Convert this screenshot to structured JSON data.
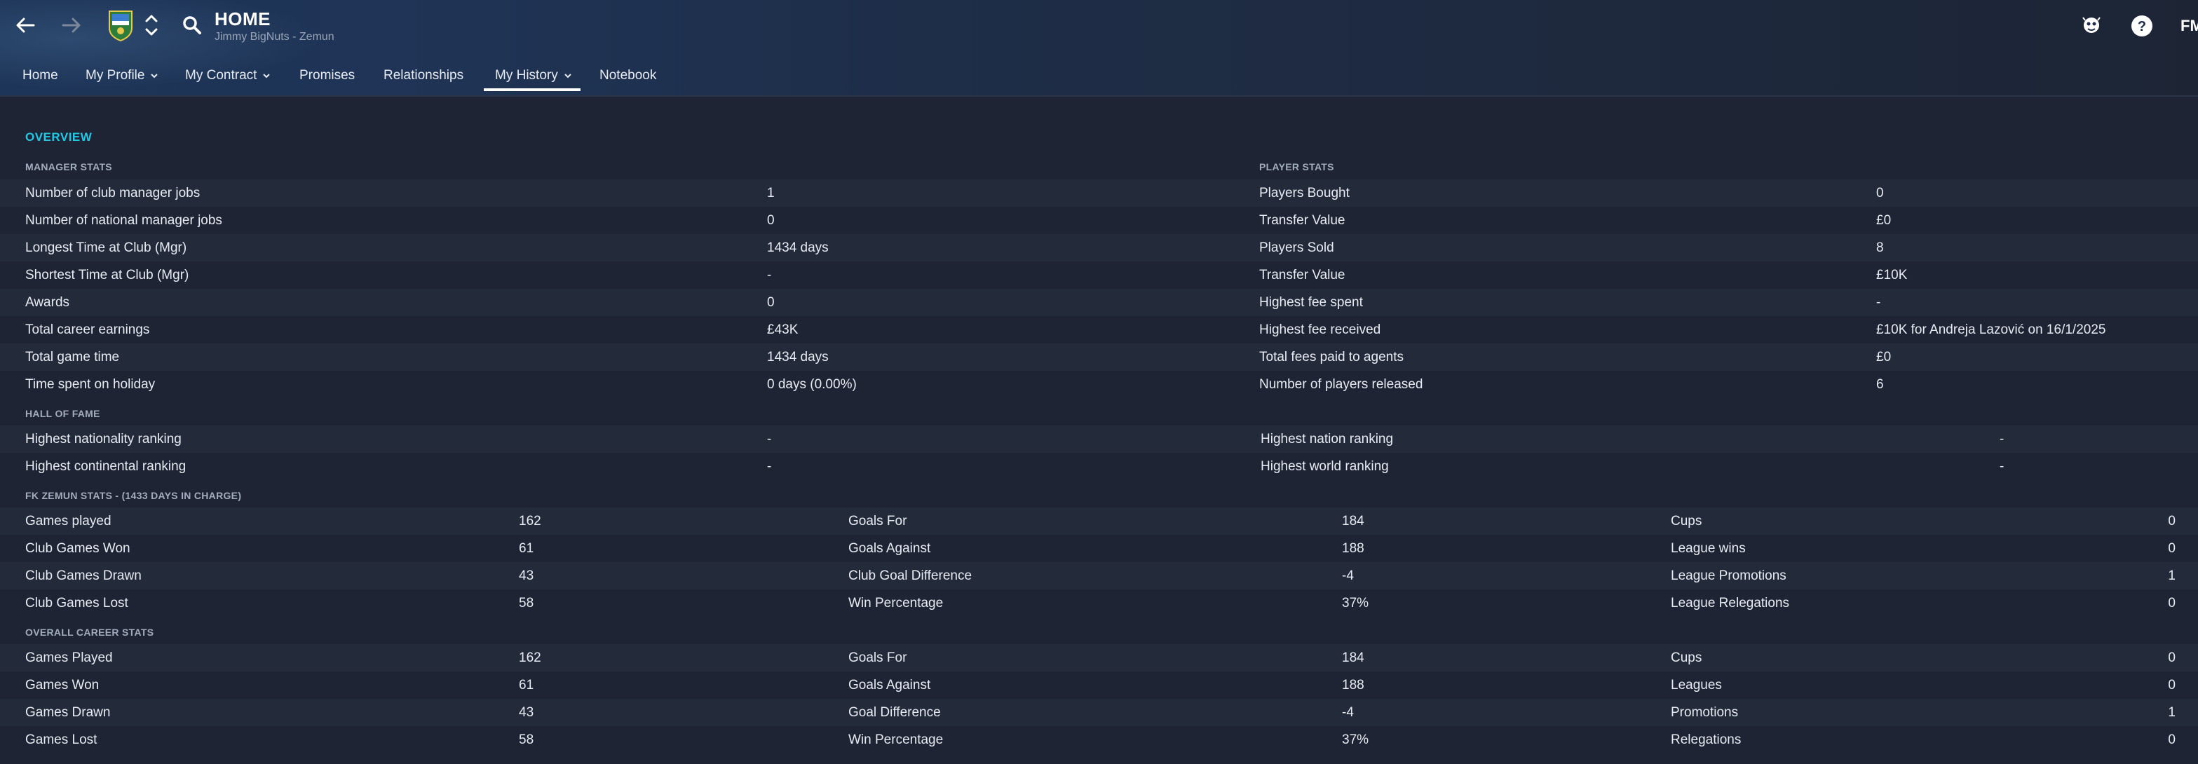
{
  "header": {
    "title": "HOME",
    "subtitle": "Jimmy BigNuts - Zemun",
    "logo_text": "FM"
  },
  "tabs": [
    {
      "label": "Home",
      "has_menu": false,
      "active": false
    },
    {
      "label": "My Profile",
      "has_menu": true,
      "active": false
    },
    {
      "label": "My Contract",
      "has_menu": true,
      "active": false
    },
    {
      "label": "Promises",
      "has_menu": false,
      "active": false
    },
    {
      "label": "Relationships",
      "has_menu": false,
      "active": false
    },
    {
      "label": "My History",
      "has_menu": true,
      "active": true
    },
    {
      "label": "Notebook",
      "has_menu": false,
      "active": false
    }
  ],
  "overview": {
    "title": "OVERVIEW",
    "manager_stats": {
      "heading": "MANAGER STATS",
      "rows": [
        {
          "label": "Number of club manager jobs",
          "value": "1"
        },
        {
          "label": "Number of national manager jobs",
          "value": "0"
        },
        {
          "label": "Longest Time at Club (Mgr)",
          "value": "1434 days"
        },
        {
          "label": "Shortest Time at Club (Mgr)",
          "value": "-"
        },
        {
          "label": "Awards",
          "value": "0"
        },
        {
          "label": "Total career earnings",
          "value": "£43K"
        },
        {
          "label": "Total game time",
          "value": "1434 days"
        },
        {
          "label": "Time spent on holiday",
          "value": "0 days (0.00%)"
        }
      ]
    },
    "player_stats": {
      "heading": "PLAYER STATS",
      "rows": [
        {
          "label": "Players Bought",
          "value": "0"
        },
        {
          "label": "Transfer Value",
          "value": "£0"
        },
        {
          "label": "Players Sold",
          "value": "8"
        },
        {
          "label": "Transfer Value",
          "value": "£10K"
        },
        {
          "label": "Highest fee spent",
          "value": "-"
        },
        {
          "label": "Highest fee received",
          "value": "£10K for Andreja Lazović on 16/1/2025"
        },
        {
          "label": "Total fees paid to agents",
          "value": "£0"
        },
        {
          "label": "Number of players released",
          "value": "6"
        }
      ]
    },
    "hall_of_fame": {
      "heading": "HALL OF FAME",
      "rows": [
        {
          "label": "Highest nationality ranking",
          "value": "-",
          "label2": "Highest nation ranking",
          "value2": "-"
        },
        {
          "label": "Highest continental ranking",
          "value": "-",
          "label2": "Highest world ranking",
          "value2": "-"
        }
      ]
    },
    "club_stats": {
      "heading": "FK ZEMUN STATS - (1433 DAYS IN CHARGE)",
      "rows": [
        {
          "l1": "Games played",
          "v1": "162",
          "l2": "Goals For",
          "v2": "184",
          "l3": "Cups",
          "v3": "0"
        },
        {
          "l1": "Club Games Won",
          "v1": "61",
          "l2": "Goals Against",
          "v2": "188",
          "l3": "League wins",
          "v3": "0"
        },
        {
          "l1": "Club Games Drawn",
          "v1": "43",
          "l2": "Club Goal Difference",
          "v2": "-4",
          "l3": "League Promotions",
          "v3": "1"
        },
        {
          "l1": "Club Games Lost",
          "v1": "58",
          "l2": "Win Percentage",
          "v2": "37%",
          "l3": "League Relegations",
          "v3": "0"
        }
      ]
    },
    "career_stats": {
      "heading": "OVERALL CAREER STATS",
      "rows": [
        {
          "l1": "Games Played",
          "v1": "162",
          "l2": "Goals For",
          "v2": "184",
          "l3": "Cups",
          "v3": "0"
        },
        {
          "l1": "Games Won",
          "v1": "61",
          "l2": "Goals Against",
          "v2": "188",
          "l3": "Leagues",
          "v3": "0"
        },
        {
          "l1": "Games Drawn",
          "v1": "43",
          "l2": "Goal Difference",
          "v2": "-4",
          "l3": "Promotions",
          "v3": "1"
        },
        {
          "l1": "Games Lost",
          "v1": "58",
          "l2": "Win Percentage",
          "v2": "37%",
          "l3": "Relegations",
          "v3": "0"
        }
      ]
    }
  },
  "colors": {
    "background": "#1e2433",
    "row_shade": "#232a3a",
    "accent": "#21c8e6",
    "header": "#1d3558"
  }
}
